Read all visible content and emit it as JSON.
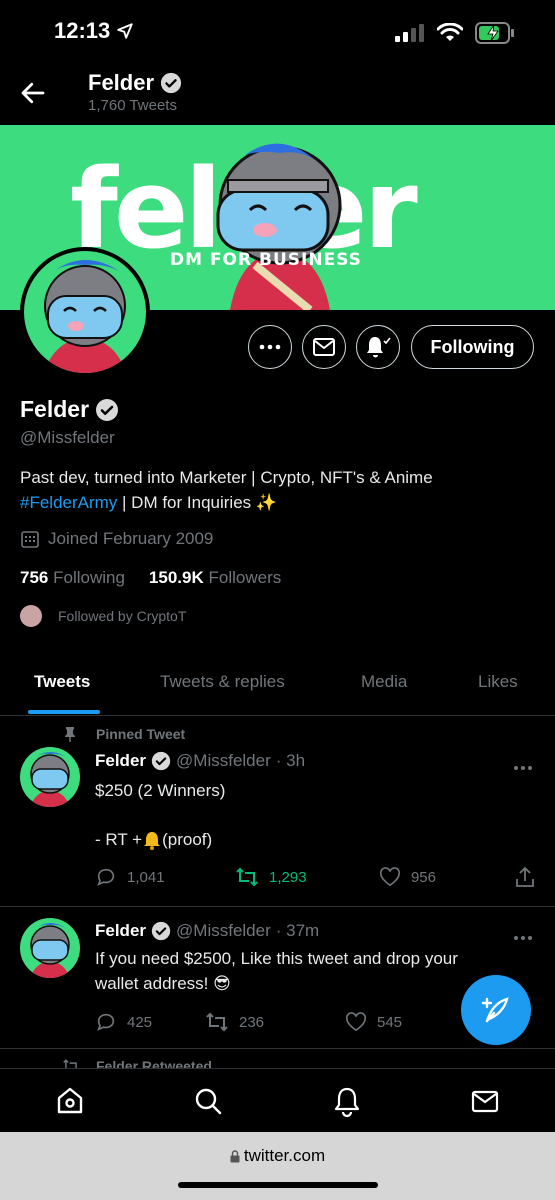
{
  "status_bar": {
    "time": "12:13"
  },
  "header": {
    "name": "Felder",
    "tweet_count": "1,760 Tweets"
  },
  "banner": {
    "title": "felder",
    "subtitle": "DM FOR BUSINESS"
  },
  "profile": {
    "name": "Felder",
    "handle": "@Missfelder",
    "bio_line1": "Past dev, turned into Marketer | Crypto, NFT's & Anime",
    "bio_hashtag": "#FelderArmy",
    "bio_line2_rest": " | DM for Inquiries ✨",
    "joined": "Joined February 2009",
    "following_count": "756",
    "following_label": "Following",
    "followers_count": "150.9K",
    "followers_label": "Followers",
    "followed_by": "Followed by CryptoT"
  },
  "actions": {
    "following_button": "Following"
  },
  "tabs": [
    {
      "label": "Tweets"
    },
    {
      "label": "Tweets & replies"
    },
    {
      "label": "Media"
    },
    {
      "label": "Likes"
    }
  ],
  "tweets": [
    {
      "pinned_label": "Pinned Tweet",
      "name": "Felder",
      "handle": "@Missfelder",
      "time": "· 3h",
      "line1": "$250 (2 Winners)",
      "line2_prefix": "- RT + ",
      "line2_suffix": "(proof)",
      "replies": "1,041",
      "retweets": "1,293",
      "likes": "956"
    },
    {
      "name": "Felder",
      "handle": "@Missfelder",
      "time": "· 37m",
      "line1": "If you need $2500, Like this tweet and drop your",
      "line2": "wallet address! 😎",
      "replies": "425",
      "retweets": "236",
      "likes": "545"
    }
  ],
  "partial_tweet": {
    "label": "Felder Retweeted"
  },
  "safari": {
    "url": "twitter.com"
  },
  "colors": {
    "accent": "#1d9bf0",
    "retweet_green": "#00ba7c",
    "banner_green": "#3ddc7e"
  }
}
